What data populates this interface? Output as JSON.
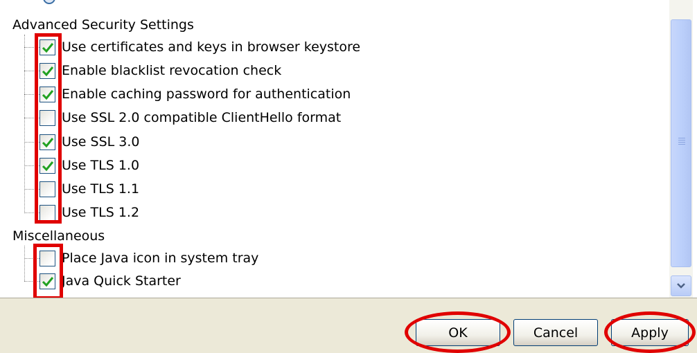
{
  "sections": {
    "advanced_security": {
      "title": "Advanced Security Settings",
      "options": [
        {
          "label": "Use certificates and keys in browser keystore",
          "checked": true
        },
        {
          "label": "Enable blacklist revocation check",
          "checked": true
        },
        {
          "label": "Enable caching password for authentication",
          "checked": true
        },
        {
          "label": "Use SSL 2.0 compatible ClientHello format",
          "checked": false
        },
        {
          "label": "Use SSL 3.0",
          "checked": true
        },
        {
          "label": "Use TLS 1.0",
          "checked": true
        },
        {
          "label": "Use TLS 1.1",
          "checked": false
        },
        {
          "label": "Use TLS 1.2",
          "checked": false
        }
      ]
    },
    "miscellaneous": {
      "title": "Miscellaneous",
      "options": [
        {
          "label": "Place Java icon in system tray",
          "checked": false
        },
        {
          "label": "Java Quick Starter",
          "checked": true
        }
      ]
    }
  },
  "buttons": {
    "ok": "OK",
    "cancel": "Cancel",
    "apply": "Apply"
  },
  "colors": {
    "highlight": "#e00000",
    "check": "#21a121",
    "footer_bg": "#ece9d8"
  },
  "icons": {
    "scroll_down": "chevron-down-icon",
    "scroll_grip": "scroll-grip-icon"
  }
}
